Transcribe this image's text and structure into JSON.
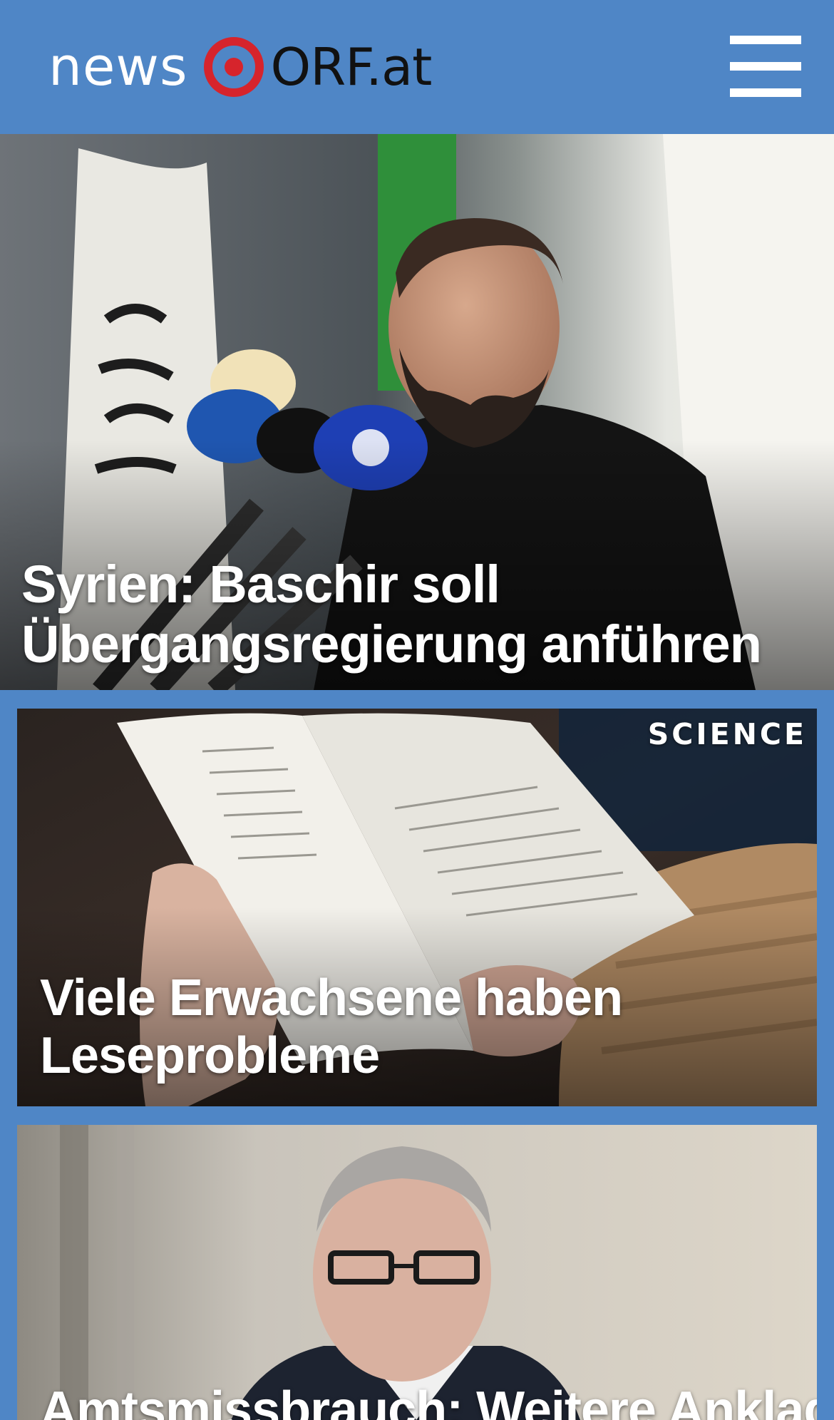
{
  "header": {
    "logo_news": "news",
    "logo_brand": "ORF.at",
    "menu_icon": "hamburger-menu-icon",
    "background_color": "#4f86c6",
    "brand_red": "#d6242c"
  },
  "articles": [
    {
      "headline": "Syrien: Baschir soll Übergangsregierung anführen",
      "image": "man-speaking-at-microphones-photo"
    },
    {
      "tag": "SCIENCE",
      "headline": "Viele Erwachsene haben Leseprobleme",
      "image": "hands-holding-open-book-photo"
    },
    {
      "headline": "Amtsmissbrauch: Weitere Anklage",
      "image": "man-with-glasses-portrait-photo"
    }
  ]
}
